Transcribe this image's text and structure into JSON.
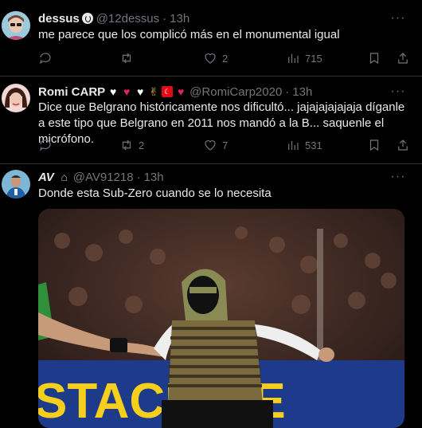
{
  "tweets": [
    {
      "name": "dessus",
      "handle": "@12dessus",
      "sep": "·",
      "time": "13h",
      "text": "me parece que los complicó más en el monumental igual",
      "counts": {
        "reply": "",
        "retweet": "",
        "like": "2",
        "views": "715"
      }
    },
    {
      "name": "Romi CARP",
      "handle": "@RomiCarp2020",
      "sep": "·",
      "time": "13h",
      "text": "Dice que Belgrano históricamente nos dificultó... jajajajajajaja díganle a este tipo que Belgrano en 2011 nos mandó a la B... saquenle el micrófono.",
      "counts": {
        "reply": "",
        "retweet": "2",
        "like": "7",
        "views": "531"
      }
    },
    {
      "name": "AV",
      "handle": "@AV91218",
      "sep": "·",
      "time": "13h",
      "text": "Donde esta Sub-Zero cuando se lo necesita"
    }
  ],
  "more_glyph": "···",
  "media": {
    "banner_text": "STACIONE",
    "colors": {
      "banner": "#f5cf1c",
      "banner_bg": "#1e3a8a",
      "crowd": "#4a2c26"
    }
  },
  "icons": [
    "verified-badge-icon",
    "reply-icon",
    "retweet-icon",
    "like-icon",
    "views-icon",
    "bookmark-icon",
    "share-icon",
    "more-icon"
  ]
}
